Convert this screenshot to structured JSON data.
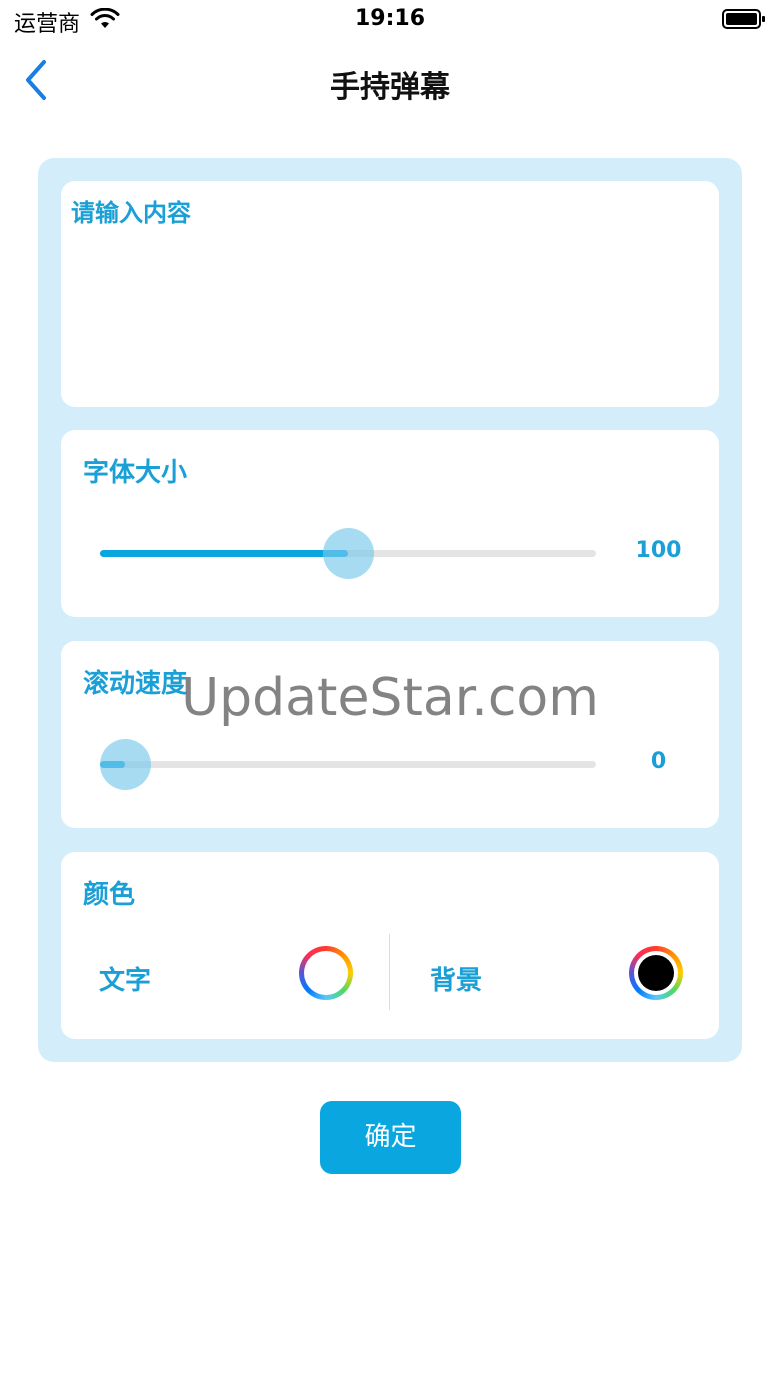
{
  "status_bar": {
    "carrier": "运营商",
    "time": "19:16",
    "wifi_icon": "wifi-icon",
    "battery_icon": "battery-icon"
  },
  "nav": {
    "title": "手持弹幕",
    "back_icon": "chevron-left-icon"
  },
  "input": {
    "placeholder": "请输入内容",
    "value": ""
  },
  "font_size": {
    "label": "字体大小",
    "value": "100",
    "level": 0.5
  },
  "scroll_speed": {
    "label": "滚动速度",
    "value": "0",
    "level": 0.05
  },
  "color": {
    "label": "颜色",
    "text_label": "文字",
    "background_label": "背景",
    "text_color": "#ffffff",
    "background_color": "#000000"
  },
  "confirm_label": "确定",
  "watermark": "UpdateStar.com",
  "colors": {
    "accent": "#0aa6e0",
    "label": "#1a9fd6",
    "panel": "#d3eefa"
  }
}
